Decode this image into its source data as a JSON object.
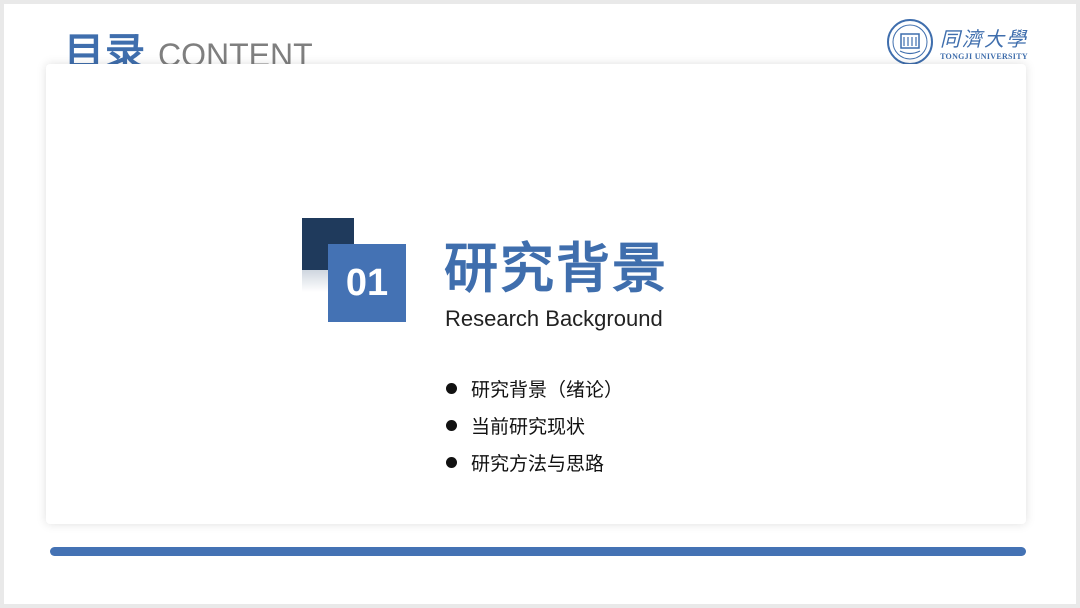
{
  "header": {
    "title_zh": "目录",
    "title_en": "CONTENT"
  },
  "logo": {
    "name_zh": "同濟大學",
    "name_en": "TONGJI UNIVERSITY"
  },
  "section": {
    "number": "01",
    "title": "研究背景",
    "subtitle": "Research Background"
  },
  "bullets": [
    "研究背景（绪论）",
    "当前研究现状",
    "研究方法与思路"
  ],
  "colors": {
    "accent": "#4472b4",
    "dark": "#1f3a5c",
    "text_grey": "#7f7f7f"
  }
}
